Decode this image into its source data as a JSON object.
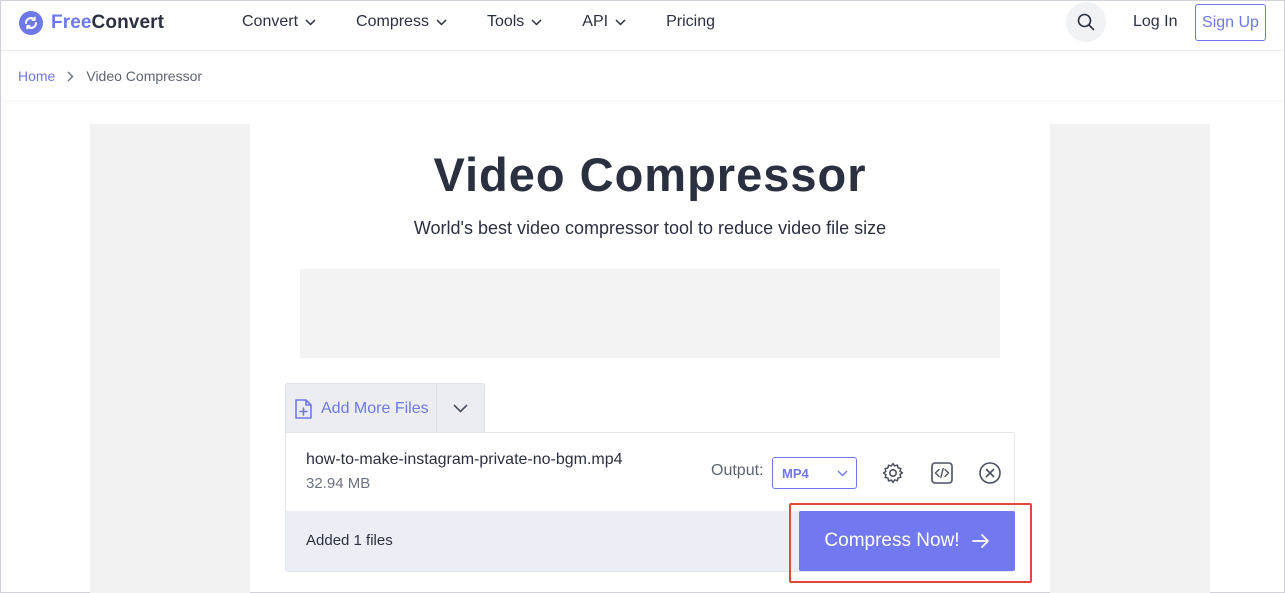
{
  "header": {
    "logo_free": "Free",
    "logo_convert": "Convert",
    "nav": [
      {
        "label": "Convert"
      },
      {
        "label": "Compress"
      },
      {
        "label": "Tools"
      },
      {
        "label": "API"
      },
      {
        "label": "Pricing"
      }
    ],
    "login_label": "Log In",
    "signup_label": "Sign Up"
  },
  "breadcrumb": {
    "home": "Home",
    "current": "Video Compressor"
  },
  "main": {
    "title": "Video Compressor",
    "subtitle": "World's best video compressor tool to reduce video file size"
  },
  "uploader": {
    "add_more_label": "Add More Files",
    "file": {
      "name": "how-to-make-instagram-private-no-bgm.mp4",
      "size": "32.94 MB",
      "output_label": "Output:",
      "output_value": "MP4"
    },
    "added_text": "Added 1 files",
    "compress_label": "Compress Now!"
  },
  "colors": {
    "accent": "#6e78e8",
    "button": "#7178f0",
    "highlight": "#e0483e"
  },
  "icons": [
    "logo-icon",
    "chevron-down-icon",
    "search-icon",
    "chevron-right-icon",
    "file-plus-icon",
    "gear-icon",
    "code-icon",
    "close-circle-icon",
    "arrow-right-icon"
  ]
}
